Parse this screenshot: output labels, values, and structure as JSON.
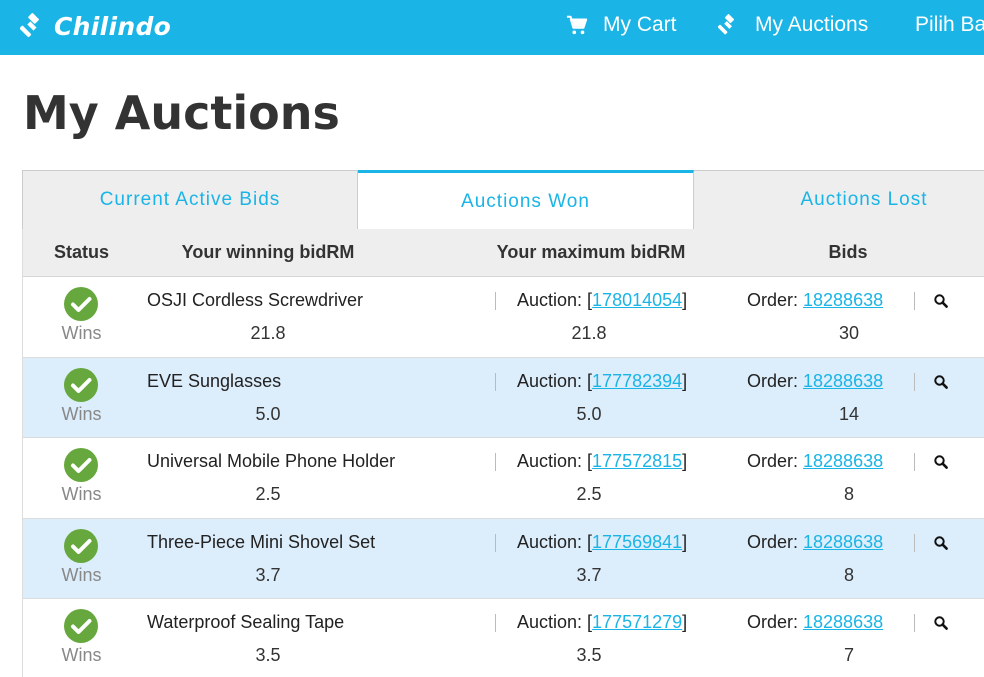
{
  "nav": {
    "brand": "Chilindo",
    "cart_label": "My Cart",
    "auctions_label": "My Auctions",
    "lang_label": "Pilih Ba"
  },
  "page": {
    "title": "My Auctions"
  },
  "tabs": [
    "Current Active Bids",
    "Auctions Won",
    "Auctions Lost"
  ],
  "active_tab": "Auctions Won",
  "table": {
    "headers": {
      "status": "Status",
      "winning_bid": "Your winning bidRM",
      "max_bid": "Your maximum bidRM",
      "bids": "Bids"
    },
    "auction_prefix": "Auction: [",
    "auction_suffix": "]",
    "order_prefix": "Order: ",
    "rows": [
      {
        "status": "Wins",
        "name": "OSJI Cordless Screwdriver",
        "winning_bid": "21.8",
        "auction_id": "178014054",
        "max_bid": "21.8",
        "order_id": "18288638",
        "bids": "30"
      },
      {
        "status": "Wins",
        "name": "EVE Sunglasses",
        "winning_bid": "5.0",
        "auction_id": "177782394",
        "max_bid": "5.0",
        "order_id": "18288638",
        "bids": "14"
      },
      {
        "status": "Wins",
        "name": "Universal Mobile Phone Holder",
        "winning_bid": "2.5",
        "auction_id": "177572815",
        "max_bid": "2.5",
        "order_id": "18288638",
        "bids": "8"
      },
      {
        "status": "Wins",
        "name": "Three-Piece Mini Shovel Set",
        "winning_bid": "3.7",
        "auction_id": "177569841",
        "max_bid": "3.7",
        "order_id": "18288638",
        "bids": "8"
      },
      {
        "status": "Wins",
        "name": "Waterproof Sealing Tape",
        "winning_bid": "3.5",
        "auction_id": "177571279",
        "max_bid": "3.5",
        "order_id": "18288638",
        "bids": "7"
      }
    ]
  },
  "colors": {
    "brand": "#1ab4e6",
    "win_green": "#66a83e",
    "row_alt": "#dcedfb",
    "header_bg": "#eeeeee"
  },
  "icons": {
    "brand": "gavel-icon",
    "cart": "cart-icon",
    "auctions": "gavel-icon",
    "status": "check-circle-icon",
    "detail": "search-icon"
  }
}
